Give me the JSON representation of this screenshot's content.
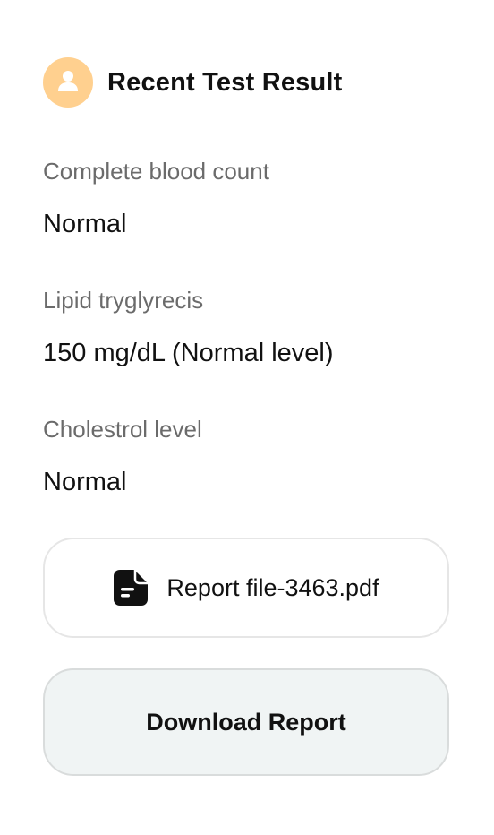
{
  "header": {
    "title": "Recent Test Result",
    "avatar_icon": "user-icon",
    "avatar_color": "#ffd08f"
  },
  "results": [
    {
      "label": "Complete blood count",
      "value": "Normal"
    },
    {
      "label": "Lipid tryglyrecis",
      "value": "150 mg/dL (Normal level)"
    },
    {
      "label": "Cholestrol level",
      "value": "Normal"
    }
  ],
  "file": {
    "name": "Report file-3463.pdf",
    "icon": "document-icon"
  },
  "actions": {
    "download_label": "Download Report",
    "download_bg": "#f0f4f4"
  }
}
